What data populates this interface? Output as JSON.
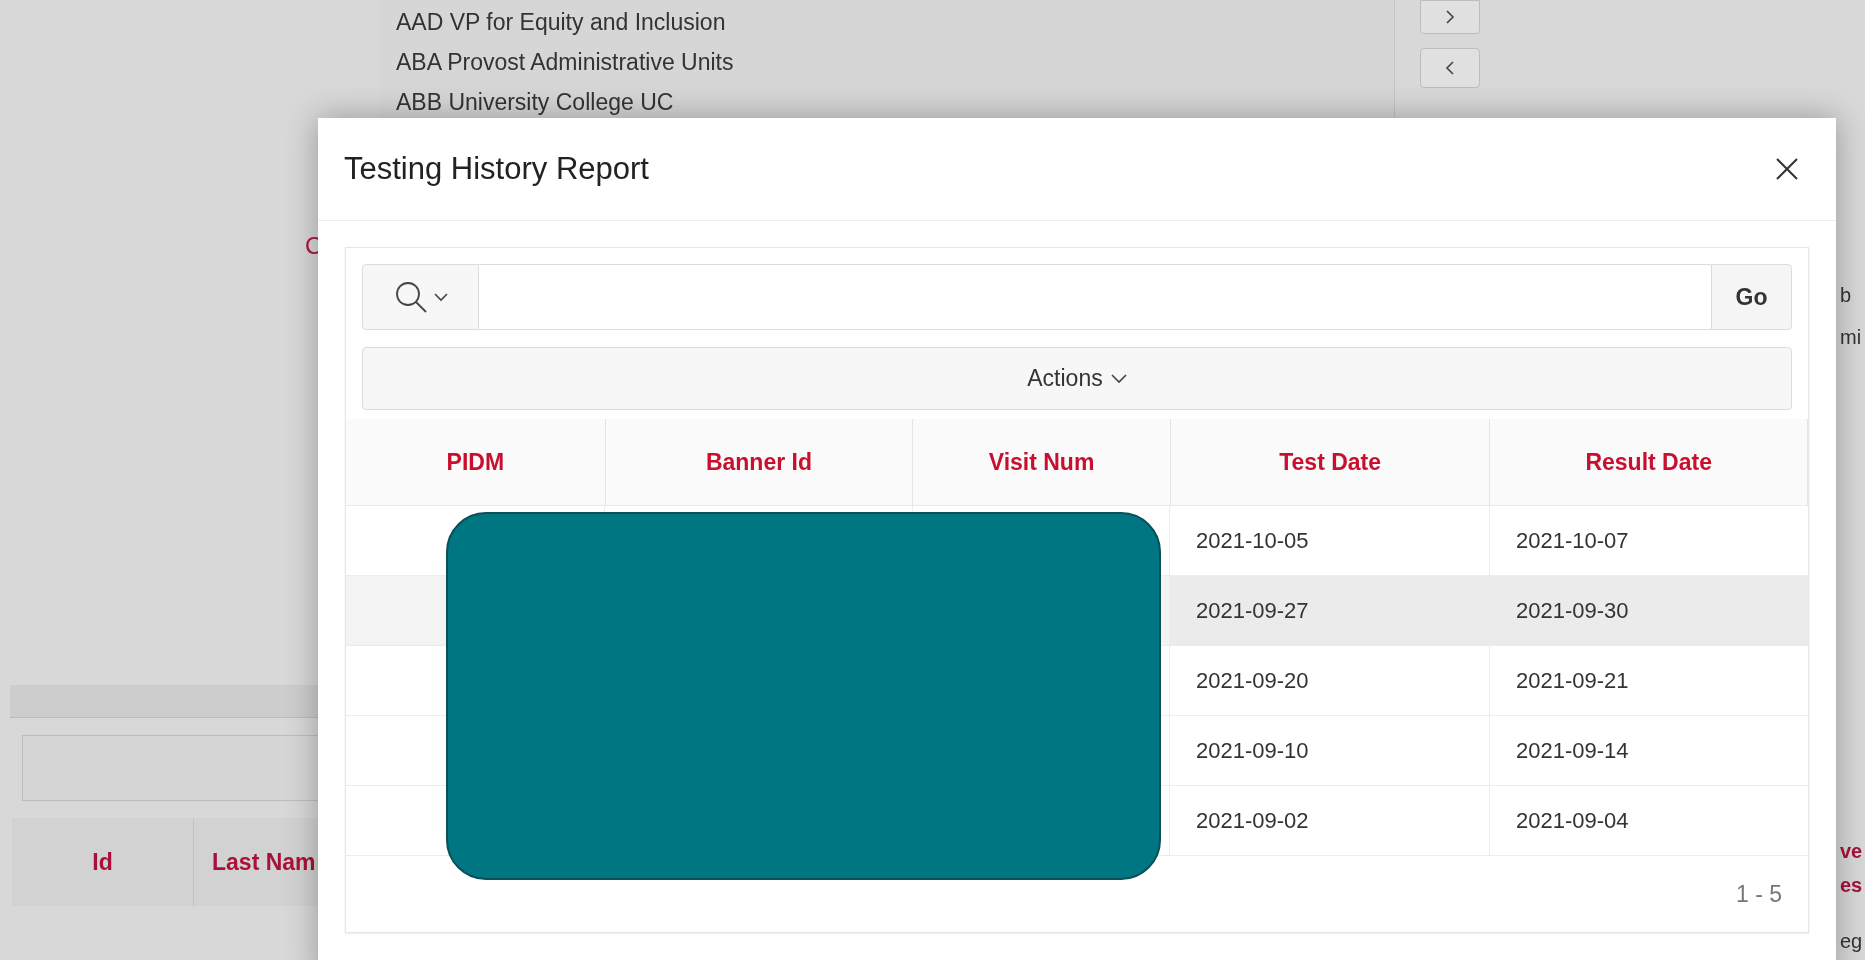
{
  "background_page": {
    "list_items": [
      "AAD VP for Equity and Inclusion",
      "ABA Provost Administrative Units",
      "ABB University College UC"
    ],
    "left_fragment": "C",
    "right_fragments": [
      "b",
      "mi"
    ],
    "grid_columns": [
      "Id",
      "Last Nam"
    ],
    "right_heading": [
      "ve",
      "es"
    ],
    "right_cell": "eg"
  },
  "dialog": {
    "title": "Testing History Report",
    "search": {
      "button": "Go"
    },
    "actions": "Actions",
    "table": {
      "columns": [
        "PIDM",
        "Banner Id",
        "Visit Num",
        "Test Date",
        "Result Date"
      ],
      "rows": [
        {
          "test_date": "2021-10-05",
          "result_date": "2021-10-07",
          "highlighted": false
        },
        {
          "test_date": "2021-09-27",
          "result_date": "2021-09-30",
          "highlighted": true
        },
        {
          "test_date": "2021-09-20",
          "result_date": "2021-09-21",
          "highlighted": false
        },
        {
          "test_date": "2021-09-10",
          "result_date": "2021-09-14",
          "highlighted": false
        },
        {
          "test_date": "2021-09-02",
          "result_date": "2021-09-04",
          "highlighted": false
        }
      ]
    },
    "pagination": "1 - 5"
  }
}
